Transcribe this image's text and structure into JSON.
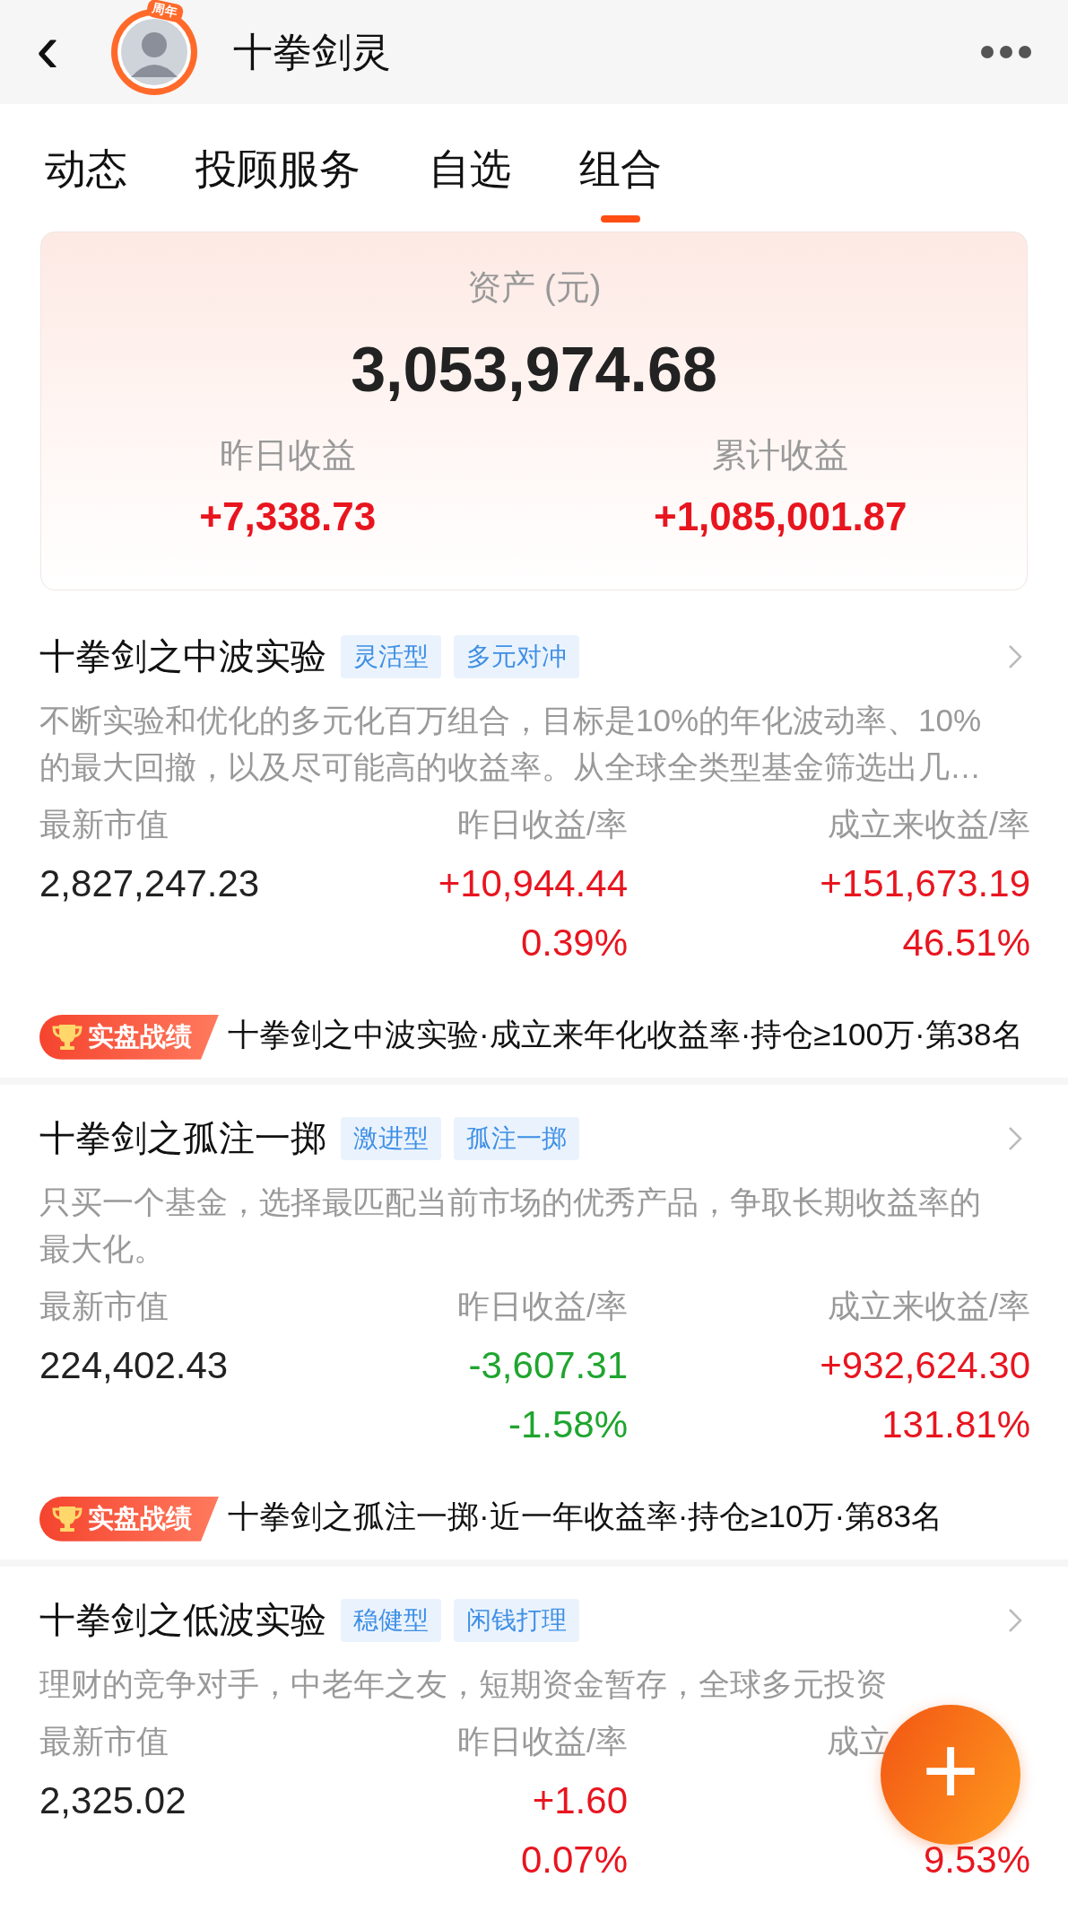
{
  "header": {
    "back": "‹",
    "title": "十拳剑灵",
    "avatar_badge": "周年"
  },
  "tabs": [
    {
      "label": "动态",
      "selected": false
    },
    {
      "label": "投顾服务",
      "selected": false
    },
    {
      "label": "自选",
      "selected": false
    },
    {
      "label": "组合",
      "selected": true
    }
  ],
  "summary": {
    "asset_label": "资产 (元)",
    "asset_value": "3,053,974.68",
    "stats": [
      {
        "label": "昨日收益",
        "value": "+7,338.73",
        "color": "#e8151f"
      },
      {
        "label": "累计收益",
        "value": "+1,085,001.87",
        "color": "#e8151f"
      }
    ]
  },
  "portfolios": [
    {
      "name": "十拳剑之中波实验",
      "tags": [
        "灵活型",
        "多元对冲"
      ],
      "description": "不断实验和优化的多元化百万组合，目标是10%的年化波动率、10%的最大回撤，以及尽可能高的收益率。从全球全类型基金筛选出几…",
      "columns": [
        {
          "label": "最新市值",
          "value": "2,827,247.23"
        },
        {
          "label": "昨日收益/率",
          "value": "+10,944.44",
          "rate": "0.39%",
          "color": "#e8151f"
        },
        {
          "label": "成立来收益/率",
          "value": "+151,673.19",
          "rate": "46.51%",
          "color": "#e8151f"
        }
      ],
      "rank_badge": "实盘战绩",
      "rank_text": "十拳剑之中波实验·成立来年化收益率·持仓≥100万·第38名"
    },
    {
      "name": "十拳剑之孤注一掷",
      "tags": [
        "激进型",
        "孤注一掷"
      ],
      "description": "只买一个基金，选择最匹配当前市场的优秀产品，争取长期收益率的最大化。",
      "columns": [
        {
          "label": "最新市值",
          "value": "224,402.43"
        },
        {
          "label": "昨日收益/率",
          "value": "-3,607.31",
          "rate": "-1.58%",
          "color": "#1fa52f"
        },
        {
          "label": "成立来收益/率",
          "value": "+932,624.30",
          "rate": "131.81%",
          "color": "#e8151f"
        }
      ],
      "rank_badge": "实盘战绩",
      "rank_text": "十拳剑之孤注一掷·近一年收益率·持仓≥10万·第83名"
    },
    {
      "name": "十拳剑之低波实验",
      "tags": [
        "稳健型",
        "闲钱打理"
      ],
      "description": "理财的竞争对手，中老年之友，短期资金暂存，全球多元投资",
      "columns": [
        {
          "label": "最新市值",
          "value": "2,325.02"
        },
        {
          "label": "昨日收益/率",
          "value": "+1.60",
          "rate": "0.07%",
          "color": "#e8151f"
        },
        {
          "label": "成立",
          "rate": "9.53%",
          "color": "#e8151f"
        }
      ]
    }
  ],
  "fab": {
    "symbol": "+"
  }
}
